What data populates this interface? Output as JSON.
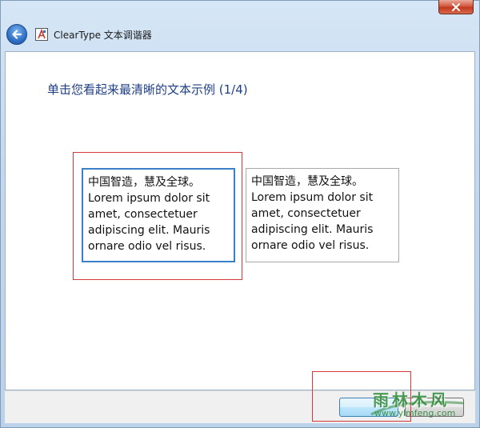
{
  "window": {
    "title": "ClearType 文本调谐器"
  },
  "instruction": "单击您看起来最清晰的文本示例 (1/4)",
  "samples": [
    {
      "line1": "中国智造，慧及全球。",
      "line2": "Lorem ipsum dolor sit",
      "line3": "amet, consectetuer",
      "line4": "adipiscing elit. Mauris",
      "line5": "ornare odio vel risus."
    },
    {
      "line1": "中国智造，慧及全球。",
      "line2": "Lorem ipsum dolor sit",
      "line3": "amet, consectetuer",
      "line4": "adipiscing elit. Mauris",
      "line5": "ornare odio vel risus."
    }
  ],
  "footer": {
    "next_label": "",
    "cancel_label": ""
  },
  "watermark": {
    "title": "雨林木风",
    "url": "www.ylmfeng.com"
  },
  "colors": {
    "instruction": "#1e3f87",
    "selected_border": "#3a7fc8",
    "highlight_outline": "#d43a3a",
    "watermark": "#2f8a3a"
  },
  "icons": {
    "back": "back-arrow-icon",
    "app": "cleartype-app-icon",
    "close": "close-icon"
  }
}
